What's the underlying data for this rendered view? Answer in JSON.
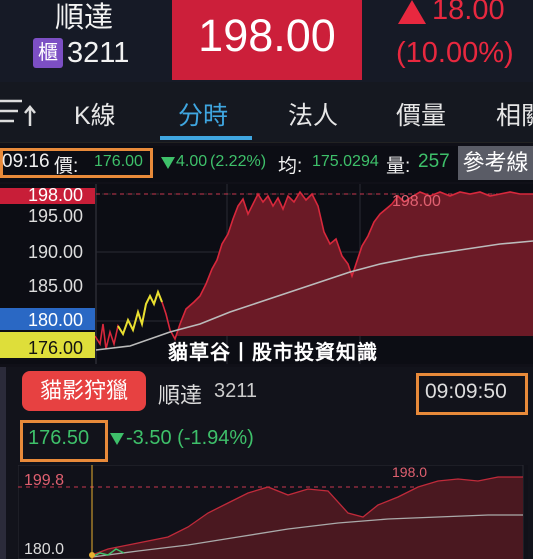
{
  "header": {
    "stock_name": "順達",
    "market_badge": "櫃",
    "stock_code": "3211",
    "price": "198.00",
    "change": "18.00",
    "change_pct": "(10.00%)",
    "up_color": "#e8283f"
  },
  "tabs": [
    "K線",
    "分時",
    "法人",
    "價量",
    "相關"
  ],
  "active_tab": "分時",
  "info_line": {
    "time": "09:16",
    "price_label": "價:",
    "price": "176.00",
    "change": "4.00",
    "change_pct": "(2.22%)",
    "avg_label": "均:",
    "avg": "175.0294",
    "volume_label": "量:",
    "volume": "257",
    "ref_button": "參考線"
  },
  "chart_main": {
    "y_ticks": [
      "198.00",
      "195.00",
      "190.00",
      "185.00",
      "180.00",
      "176.00"
    ],
    "limit_label": "198.00"
  },
  "watermark": "貓草谷丨股市投資知識",
  "section2": {
    "button": "貓影狩獵",
    "stock_name": "順達",
    "stock_code": "3211",
    "time": "09:09:50",
    "price": "176.50",
    "change": "-3.50",
    "change_pct": "(-1.94%)",
    "y_top": "199.8",
    "y_bottom": "180.0",
    "limit_label": "198.0"
  }
}
